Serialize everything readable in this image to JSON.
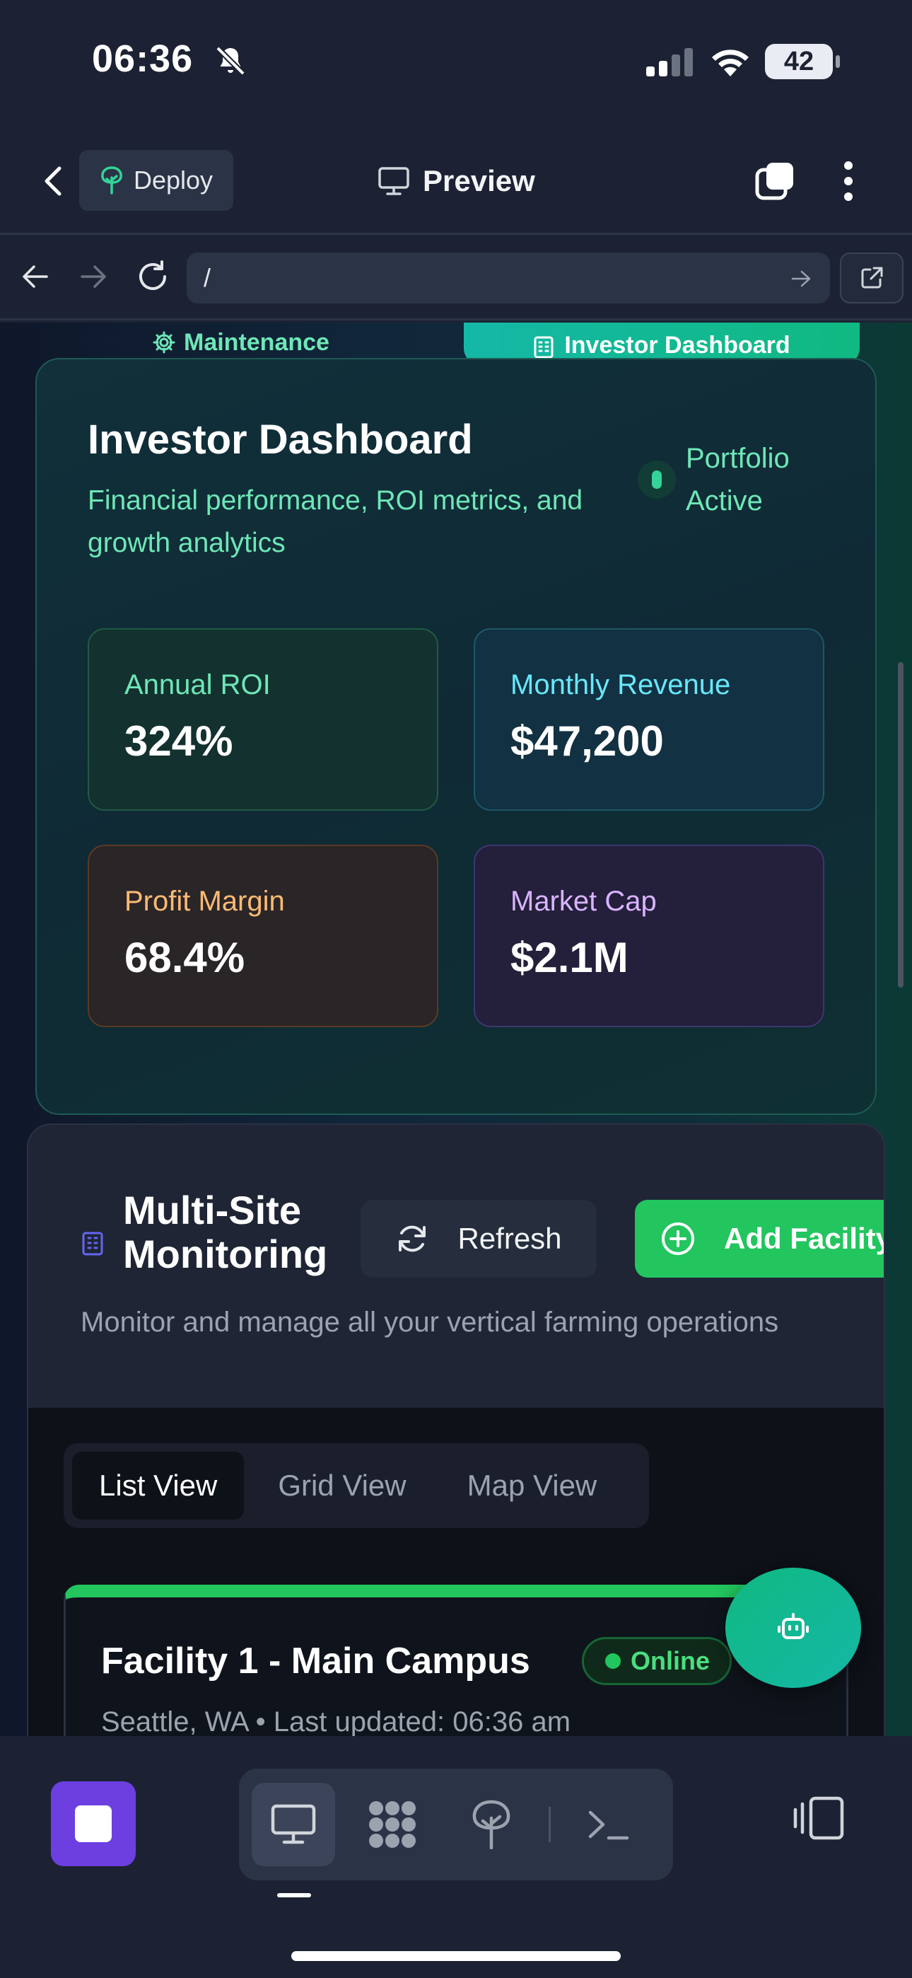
{
  "status_bar": {
    "time": "06:36",
    "battery": "42",
    "icons": [
      "bell-slash-icon",
      "signal-icon",
      "wifi-icon",
      "battery-icon"
    ]
  },
  "header": {
    "deploy_label": "Deploy",
    "preview_label": "Preview",
    "icons": [
      "chevron-left-icon",
      "tree-icon",
      "monitor-icon",
      "tabs-icon",
      "more-vertical-icon"
    ]
  },
  "browser": {
    "url": "/",
    "icons": [
      "arrow-left-icon",
      "arrow-right-icon",
      "reload-icon",
      "arrow-right-small-icon",
      "external-link-icon"
    ]
  },
  "dashboard_tabs": {
    "maintenance": "Maintenance",
    "investor": "Investor Dashboard"
  },
  "investor": {
    "title": "Investor Dashboard",
    "subtitle": "Financial performance, ROI metrics, and growth analytics",
    "status": "Portfolio Active",
    "metrics": [
      {
        "label": "Annual ROI",
        "value": "324%"
      },
      {
        "label": "Monthly Revenue",
        "value": "$47,200"
      },
      {
        "label": "Profit Margin",
        "value": "68.4%"
      },
      {
        "label": "Market Cap",
        "value": "$2.1M"
      }
    ]
  },
  "monitoring": {
    "title": "Multi-Site Monitoring",
    "subtitle": "Monitor and manage all your vertical farming operations",
    "refresh_label": "Refresh",
    "add_label": "Add Facility",
    "view_tabs": [
      "List View",
      "Grid View",
      "Map View"
    ],
    "active_view": "List View",
    "facility": {
      "name": "Facility 1 - Main Campus",
      "status": "Online",
      "meta": "Seattle, WA • Last updated: 06:36 am"
    }
  },
  "colors": {
    "accent_green": "#22c55e",
    "teal": "#14b8a6",
    "mint_text": "#6ee7b7",
    "stop_purple": "#6d3fe0"
  },
  "toolbar": {
    "icons": [
      "stop-icon",
      "desktop-icon",
      "grid-apps-icon",
      "tree-icon",
      "terminal-icon",
      "devices-icon"
    ]
  }
}
